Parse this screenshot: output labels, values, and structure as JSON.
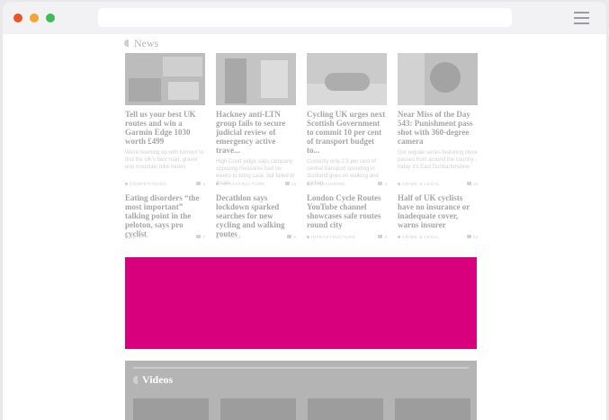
{
  "browser": {
    "buttons": [
      "close",
      "minimize",
      "maximize"
    ],
    "menu_icon": "hamburger-menu-icon"
  },
  "news": {
    "heading": "News",
    "articles": [
      {
        "headline": "Tell us your best UK routes and win a Garmin Edge 1030 worth £499",
        "excerpt": "We're teaming up with komoot to find the UK's best road, gravel and mountain bike routes",
        "tag": "Competitions",
        "comments": "4"
      },
      {
        "headline": "Hackney anti-LTN group fails to secure judicial review of emergency active trave...",
        "excerpt": "High Court judge says company opposing measures had six weeks to bring case, but failed to do so",
        "tag": "Infrastructure",
        "comments": "14"
      },
      {
        "headline": "Cycling UK urges next Scottish Government to commit 10 per cent of transport budget to...",
        "excerpt": "Currently only 2.5 per cent of central transport spending in Scotland goes on walking and cycling",
        "tag": "Campaigning",
        "comments": "4"
      },
      {
        "headline": "Near Miss of the Day 543: Punishment pass shot with 360-degree camera",
        "excerpt": "Our regular series featuring close passes from around the country - today it's East Dunbartonshire",
        "tag": "Crime & Legal",
        "comments": "13"
      },
      {
        "headline": "Eating disorders “the most important” talking point in the peloton, says pro cyclist",
        "tag": "Health",
        "comments": "7"
      },
      {
        "headline": "Decathlon says lockdown sparked searches for new cycling and walking routes",
        "tag": "Fitness",
        "comments": "2"
      },
      {
        "headline": "London Cycle Routes YouTube channel showcases safe routes round city",
        "tag": "Infrastructure",
        "comments": "4"
      },
      {
        "headline": "Half of UK cyclists have no insurance or inadequate cover, warns insurer",
        "tag": "Crime & Legal",
        "comments": "14"
      }
    ]
  },
  "videos": {
    "heading": "Videos"
  },
  "colors": {
    "ad_banner": "#d9007e",
    "videos_panel": "#b4b4b4"
  }
}
